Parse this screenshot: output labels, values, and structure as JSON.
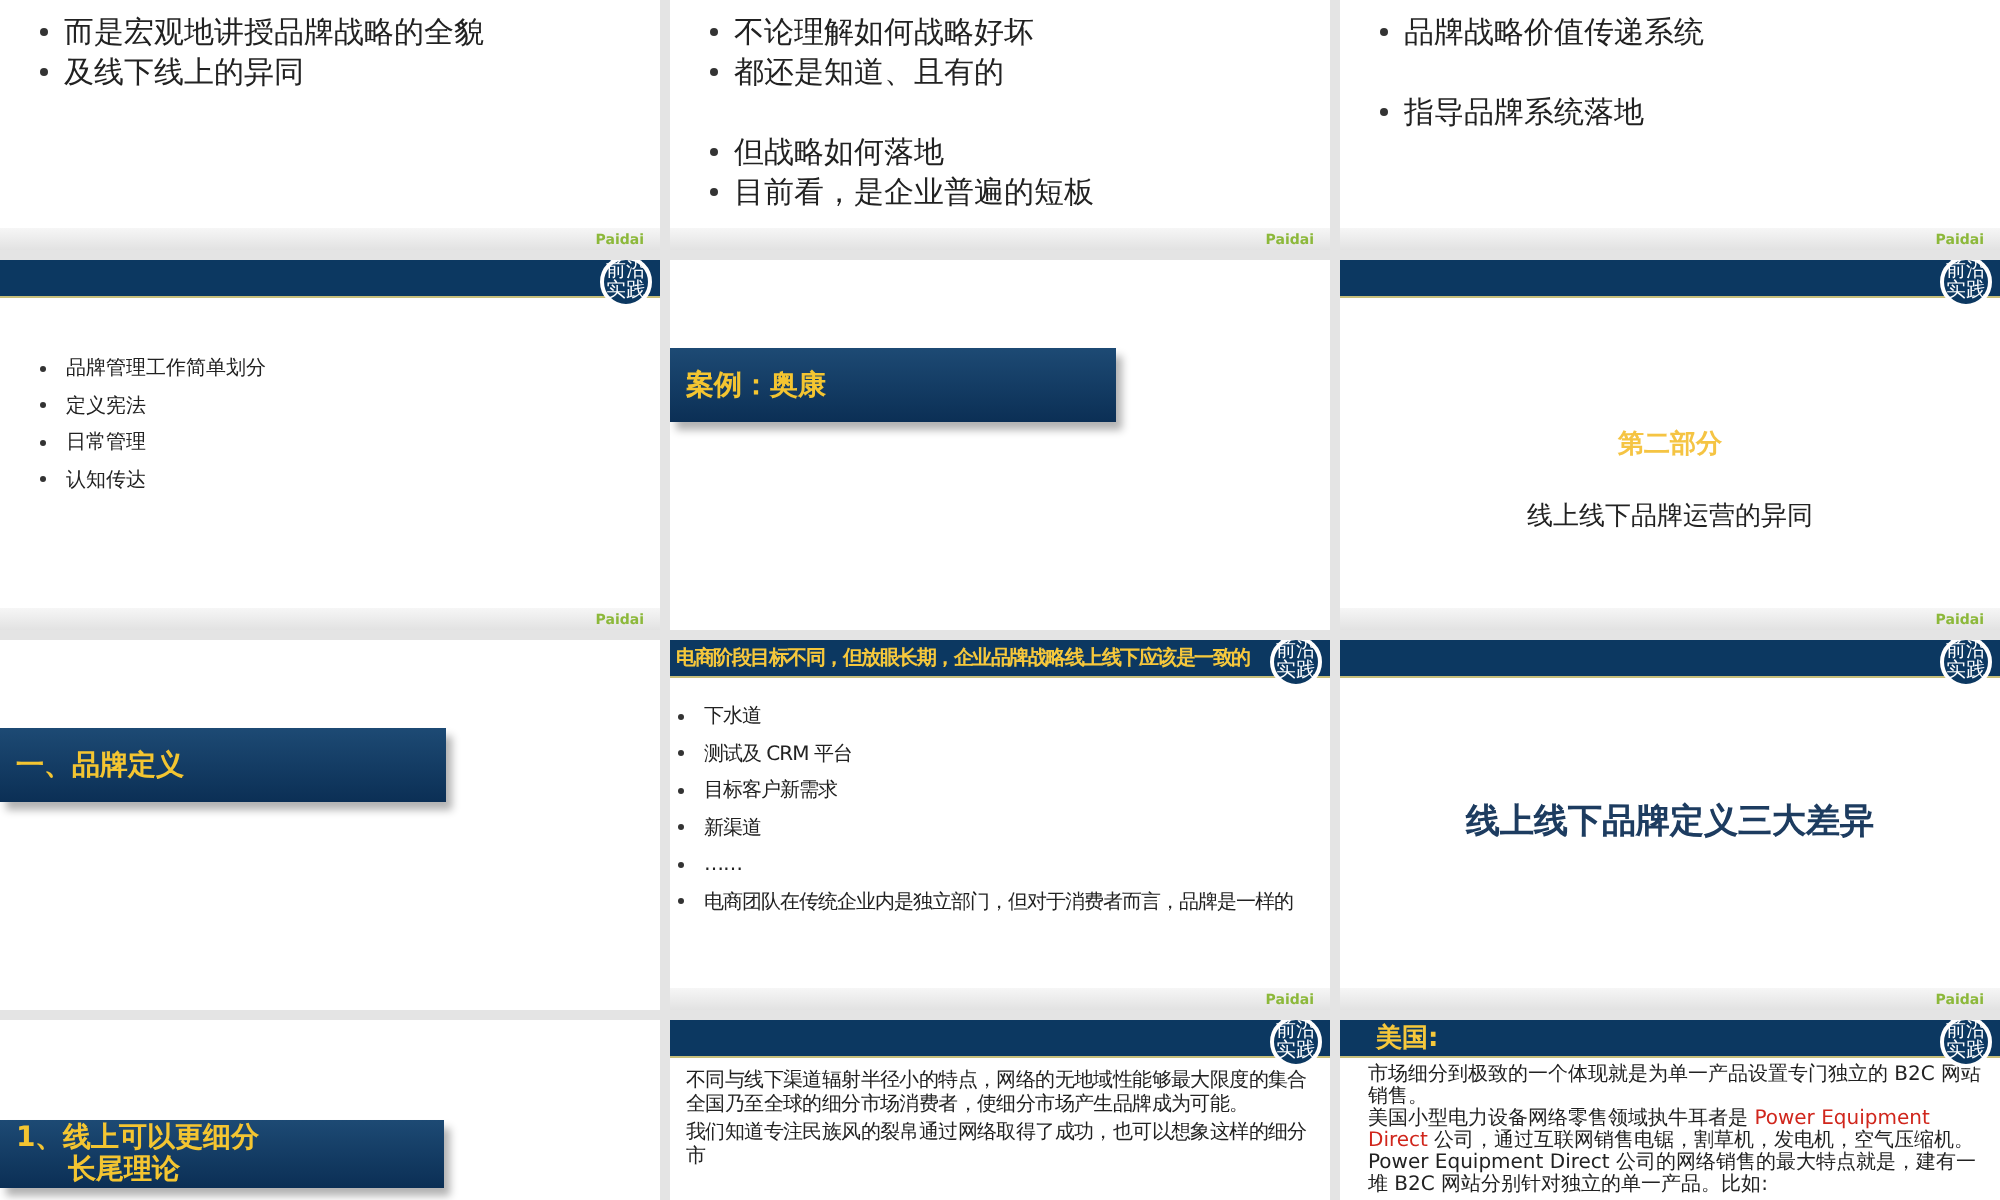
{
  "slides": [
    {
      "kind": "bullets",
      "header": false,
      "footer_logo": "Paidai",
      "groups": [
        [
          "而是宏观地讲授品牌战略的全貌",
          "及线下线上的异同"
        ]
      ]
    },
    {
      "kind": "bullets",
      "header": false,
      "footer_logo": "Paidai",
      "groups": [
        [
          "不论理解如何战略好坏",
          "都还是知道、且有的"
        ],
        [
          "但战略如何落地",
          "目前看，是企业普遍的短板"
        ]
      ]
    },
    {
      "kind": "bullets",
      "header": false,
      "footer_logo": "Paidai",
      "groups": [
        [
          "品牌战略价值传递系统"
        ],
        [
          "指导品牌系统落地"
        ]
      ]
    },
    {
      "kind": "list",
      "header": true,
      "badge": "前沿实践",
      "footer_logo": "Paidai",
      "items": [
        "品牌管理工作简单划分",
        "定义宪法",
        "日常管理",
        "认知传达"
      ]
    },
    {
      "kind": "banner",
      "header": false,
      "lines": [
        "案例：奥康"
      ]
    },
    {
      "kind": "section",
      "header": true,
      "badge": "前沿实践",
      "footer_logo": "Paidai",
      "label": "第二部分",
      "title": "线上线下品牌运营的异同"
    },
    {
      "kind": "banner",
      "header": false,
      "lines": [
        "一、品牌定义"
      ]
    },
    {
      "kind": "list",
      "header": true,
      "heading": "电商阶段目标不同，但放眼长期，企业品牌战略线上线下应该是一致的",
      "badge": "前沿实践",
      "footer_logo": "Paidai",
      "items": [
        "下水道",
        "测试及 CRM 平台",
        "目标客户新需求",
        "新渠道",
        "……",
        "电商团队在传统企业内是独立部门，但对于消费者而言，品牌是一样的"
      ]
    },
    {
      "kind": "title",
      "header": true,
      "badge": "前沿实践",
      "footer_logo": "Paidai",
      "title": "线上线下品牌定义三大差异"
    },
    {
      "kind": "banner",
      "header": false,
      "lines": [
        "1、线上可以更细分",
        "长尾理论"
      ]
    },
    {
      "kind": "paragraphs",
      "header": true,
      "badge": "前沿实践",
      "paragraphs": [
        [
          {
            "text": "不同与线下渠道辐射半径小的特点，网络的无地域性能够最大限度的集合全国乃至全球的细分市场消费者，使细分市场产生品牌成为可能。",
            "highlight": false
          }
        ],
        [
          {
            "text": "我们知道专注民族风的裂帛通过网络取得了成功，也可以想象这样的细分市",
            "highlight": false
          }
        ]
      ]
    },
    {
      "kind": "paragraphs",
      "header": true,
      "heading": "美国:",
      "badge": "前沿实践",
      "paragraphs": [
        [
          {
            "text": "市场细分到极致的一个体现就是为单一产品设置专门独立的 B2C 网站销售。",
            "highlight": false
          }
        ],
        [
          {
            "text": "美国小型电力设备网络零售领域执牛耳者是 ",
            "highlight": false
          },
          {
            "text": "Power Equipment Direct",
            "highlight": true
          },
          {
            "text": " 公司，通过互联网销售电锯，割草机，发电机，空气压缩机。",
            "highlight": false
          }
        ],
        [
          {
            "text": "Power Equipment Direct 公司的网络销售的最大特点就是，建有一堆 B2C 网站分别针对独立的单一产品。比如:",
            "highlight": false
          }
        ]
      ]
    }
  ]
}
